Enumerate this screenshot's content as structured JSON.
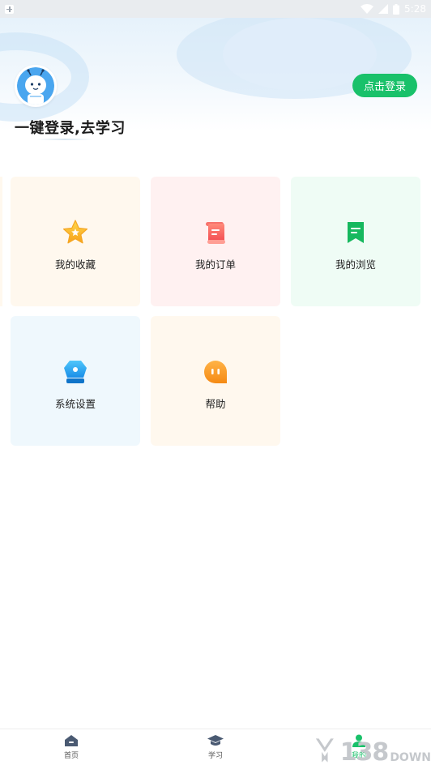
{
  "status_bar": {
    "time": "5:28",
    "icons": [
      "notification-icon",
      "wifi-icon",
      "signal-icon",
      "battery-icon"
    ]
  },
  "profile": {
    "avatar_icon": "cartoon-avatar",
    "login_button": "点击登录",
    "login_prompt": "一键登录,去学习"
  },
  "menu": [
    {
      "label": "我的收藏",
      "icon": "star-icon",
      "bg": "#fff8ee"
    },
    {
      "label": "我的订单",
      "icon": "order-scroll-icon",
      "bg": "#fff1f1"
    },
    {
      "label": "我的浏览",
      "icon": "bookmark-icon",
      "bg": "#effcf5"
    },
    {
      "label": "系统设置",
      "icon": "settings-icon",
      "bg": "#eff8fd"
    },
    {
      "label": "帮助",
      "icon": "help-chat-icon",
      "bg": "#fff8ee"
    }
  ],
  "bottom_nav": [
    {
      "label": "首页",
      "icon": "home-icon",
      "active": false
    },
    {
      "label": "学习",
      "icon": "graduation-cap-icon",
      "active": false
    },
    {
      "label": "我的",
      "icon": "user-icon",
      "active": true
    }
  ],
  "watermark": {
    "number": "138",
    "suffix": "DOWN"
  },
  "colors": {
    "accent": "#19c16a",
    "header_bg": "#e6f2fb"
  }
}
